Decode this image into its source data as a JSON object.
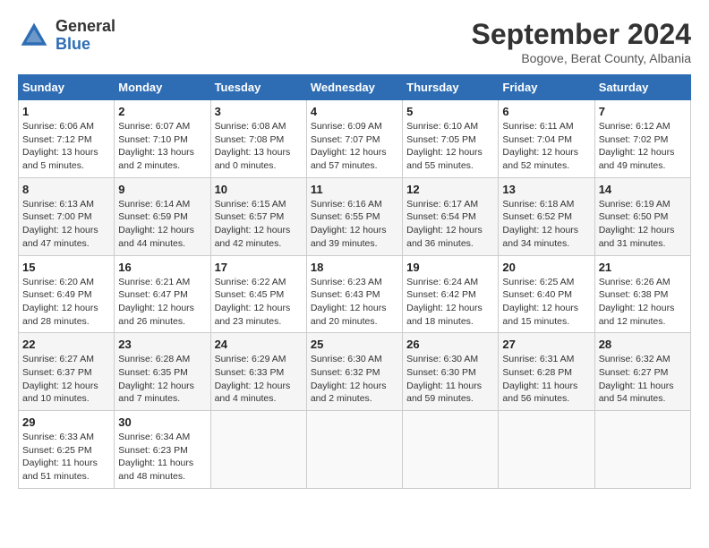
{
  "header": {
    "logo_general": "General",
    "logo_blue": "Blue",
    "main_title": "September 2024",
    "subtitle": "Bogove, Berat County, Albania"
  },
  "weekdays": [
    "Sunday",
    "Monday",
    "Tuesday",
    "Wednesday",
    "Thursday",
    "Friday",
    "Saturday"
  ],
  "weeks": [
    [
      {
        "day": "1",
        "info": "Sunrise: 6:06 AM\nSunset: 7:12 PM\nDaylight: 13 hours and 5 minutes."
      },
      {
        "day": "2",
        "info": "Sunrise: 6:07 AM\nSunset: 7:10 PM\nDaylight: 13 hours and 2 minutes."
      },
      {
        "day": "3",
        "info": "Sunrise: 6:08 AM\nSunset: 7:08 PM\nDaylight: 13 hours and 0 minutes."
      },
      {
        "day": "4",
        "info": "Sunrise: 6:09 AM\nSunset: 7:07 PM\nDaylight: 12 hours and 57 minutes."
      },
      {
        "day": "5",
        "info": "Sunrise: 6:10 AM\nSunset: 7:05 PM\nDaylight: 12 hours and 55 minutes."
      },
      {
        "day": "6",
        "info": "Sunrise: 6:11 AM\nSunset: 7:04 PM\nDaylight: 12 hours and 52 minutes."
      },
      {
        "day": "7",
        "info": "Sunrise: 6:12 AM\nSunset: 7:02 PM\nDaylight: 12 hours and 49 minutes."
      }
    ],
    [
      {
        "day": "8",
        "info": "Sunrise: 6:13 AM\nSunset: 7:00 PM\nDaylight: 12 hours and 47 minutes."
      },
      {
        "day": "9",
        "info": "Sunrise: 6:14 AM\nSunset: 6:59 PM\nDaylight: 12 hours and 44 minutes."
      },
      {
        "day": "10",
        "info": "Sunrise: 6:15 AM\nSunset: 6:57 PM\nDaylight: 12 hours and 42 minutes."
      },
      {
        "day": "11",
        "info": "Sunrise: 6:16 AM\nSunset: 6:55 PM\nDaylight: 12 hours and 39 minutes."
      },
      {
        "day": "12",
        "info": "Sunrise: 6:17 AM\nSunset: 6:54 PM\nDaylight: 12 hours and 36 minutes."
      },
      {
        "day": "13",
        "info": "Sunrise: 6:18 AM\nSunset: 6:52 PM\nDaylight: 12 hours and 34 minutes."
      },
      {
        "day": "14",
        "info": "Sunrise: 6:19 AM\nSunset: 6:50 PM\nDaylight: 12 hours and 31 minutes."
      }
    ],
    [
      {
        "day": "15",
        "info": "Sunrise: 6:20 AM\nSunset: 6:49 PM\nDaylight: 12 hours and 28 minutes."
      },
      {
        "day": "16",
        "info": "Sunrise: 6:21 AM\nSunset: 6:47 PM\nDaylight: 12 hours and 26 minutes."
      },
      {
        "day": "17",
        "info": "Sunrise: 6:22 AM\nSunset: 6:45 PM\nDaylight: 12 hours and 23 minutes."
      },
      {
        "day": "18",
        "info": "Sunrise: 6:23 AM\nSunset: 6:43 PM\nDaylight: 12 hours and 20 minutes."
      },
      {
        "day": "19",
        "info": "Sunrise: 6:24 AM\nSunset: 6:42 PM\nDaylight: 12 hours and 18 minutes."
      },
      {
        "day": "20",
        "info": "Sunrise: 6:25 AM\nSunset: 6:40 PM\nDaylight: 12 hours and 15 minutes."
      },
      {
        "day": "21",
        "info": "Sunrise: 6:26 AM\nSunset: 6:38 PM\nDaylight: 12 hours and 12 minutes."
      }
    ],
    [
      {
        "day": "22",
        "info": "Sunrise: 6:27 AM\nSunset: 6:37 PM\nDaylight: 12 hours and 10 minutes."
      },
      {
        "day": "23",
        "info": "Sunrise: 6:28 AM\nSunset: 6:35 PM\nDaylight: 12 hours and 7 minutes."
      },
      {
        "day": "24",
        "info": "Sunrise: 6:29 AM\nSunset: 6:33 PM\nDaylight: 12 hours and 4 minutes."
      },
      {
        "day": "25",
        "info": "Sunrise: 6:30 AM\nSunset: 6:32 PM\nDaylight: 12 hours and 2 minutes."
      },
      {
        "day": "26",
        "info": "Sunrise: 6:30 AM\nSunset: 6:30 PM\nDaylight: 11 hours and 59 minutes."
      },
      {
        "day": "27",
        "info": "Sunrise: 6:31 AM\nSunset: 6:28 PM\nDaylight: 11 hours and 56 minutes."
      },
      {
        "day": "28",
        "info": "Sunrise: 6:32 AM\nSunset: 6:27 PM\nDaylight: 11 hours and 54 minutes."
      }
    ],
    [
      {
        "day": "29",
        "info": "Sunrise: 6:33 AM\nSunset: 6:25 PM\nDaylight: 11 hours and 51 minutes."
      },
      {
        "day": "30",
        "info": "Sunrise: 6:34 AM\nSunset: 6:23 PM\nDaylight: 11 hours and 48 minutes."
      },
      {
        "day": "",
        "info": ""
      },
      {
        "day": "",
        "info": ""
      },
      {
        "day": "",
        "info": ""
      },
      {
        "day": "",
        "info": ""
      },
      {
        "day": "",
        "info": ""
      }
    ]
  ]
}
